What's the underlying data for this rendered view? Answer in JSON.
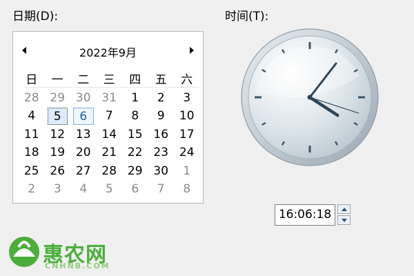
{
  "date_label": "日期(D):",
  "time_label": "时间(T):",
  "calendar": {
    "month_title": "2022年9月",
    "weekdays": [
      "日",
      "一",
      "二",
      "三",
      "四",
      "五",
      "六"
    ],
    "weeks": [
      [
        {
          "d": "28",
          "dim": true
        },
        {
          "d": "29",
          "dim": true
        },
        {
          "d": "30",
          "dim": true
        },
        {
          "d": "31",
          "dim": true
        },
        {
          "d": "1"
        },
        {
          "d": "2"
        },
        {
          "d": "3"
        }
      ],
      [
        {
          "d": "4"
        },
        {
          "d": "5",
          "today": true
        },
        {
          "d": "6",
          "selected": true
        },
        {
          "d": "7"
        },
        {
          "d": "8"
        },
        {
          "d": "9"
        },
        {
          "d": "10"
        }
      ],
      [
        {
          "d": "11"
        },
        {
          "d": "12"
        },
        {
          "d": "13"
        },
        {
          "d": "14"
        },
        {
          "d": "15"
        },
        {
          "d": "16"
        },
        {
          "d": "17"
        }
      ],
      [
        {
          "d": "18"
        },
        {
          "d": "19"
        },
        {
          "d": "20"
        },
        {
          "d": "21"
        },
        {
          "d": "22"
        },
        {
          "d": "23"
        },
        {
          "d": "24"
        }
      ],
      [
        {
          "d": "25"
        },
        {
          "d": "26"
        },
        {
          "d": "27"
        },
        {
          "d": "28"
        },
        {
          "d": "29"
        },
        {
          "d": "30"
        },
        {
          "d": "1",
          "dim": true
        }
      ],
      [
        {
          "d": "2",
          "dim": true
        },
        {
          "d": "3",
          "dim": true
        },
        {
          "d": "4",
          "dim": true
        },
        {
          "d": "5",
          "dim": true
        },
        {
          "d": "6",
          "dim": true
        },
        {
          "d": "7",
          "dim": true
        },
        {
          "d": "8",
          "dim": true
        }
      ]
    ]
  },
  "clock": {
    "hour": 16,
    "minute": 6,
    "second": 18
  },
  "time_value": "16:06:18",
  "watermark": {
    "name": "惠农网",
    "domain": "CNHNB.COM",
    "color": "#4cae3c"
  }
}
